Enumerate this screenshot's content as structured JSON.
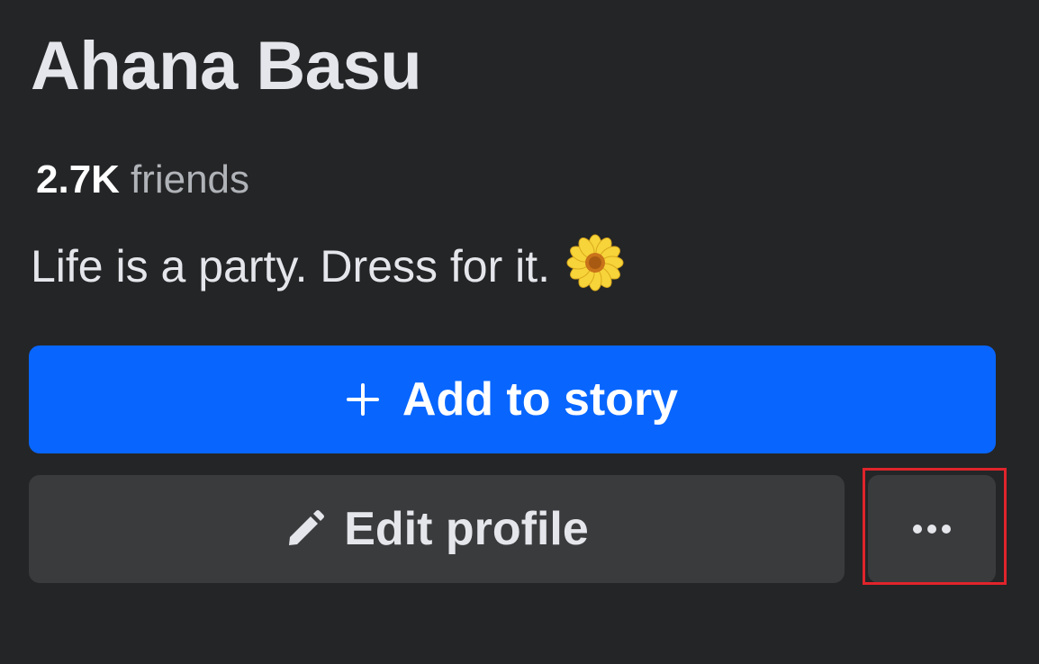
{
  "profile": {
    "name": "Ahana Basu",
    "friends_count": "2.7K",
    "friends_label": "friends",
    "bio_text": "Life is a party. Dress for it.",
    "bio_emoji": "flower-icon"
  },
  "actions": {
    "add_story_label": "Add to story",
    "add_story_icon": "plus-icon",
    "edit_profile_label": "Edit profile",
    "edit_profile_icon": "pencil-icon",
    "more_icon": "more-options-icon"
  },
  "colors": {
    "background": "#242526",
    "primary_button": "#0866ff",
    "secondary_button": "#3a3b3c",
    "text_primary": "#e4e6eb",
    "text_secondary": "#b0b3b8",
    "highlight": "#e0242c"
  }
}
